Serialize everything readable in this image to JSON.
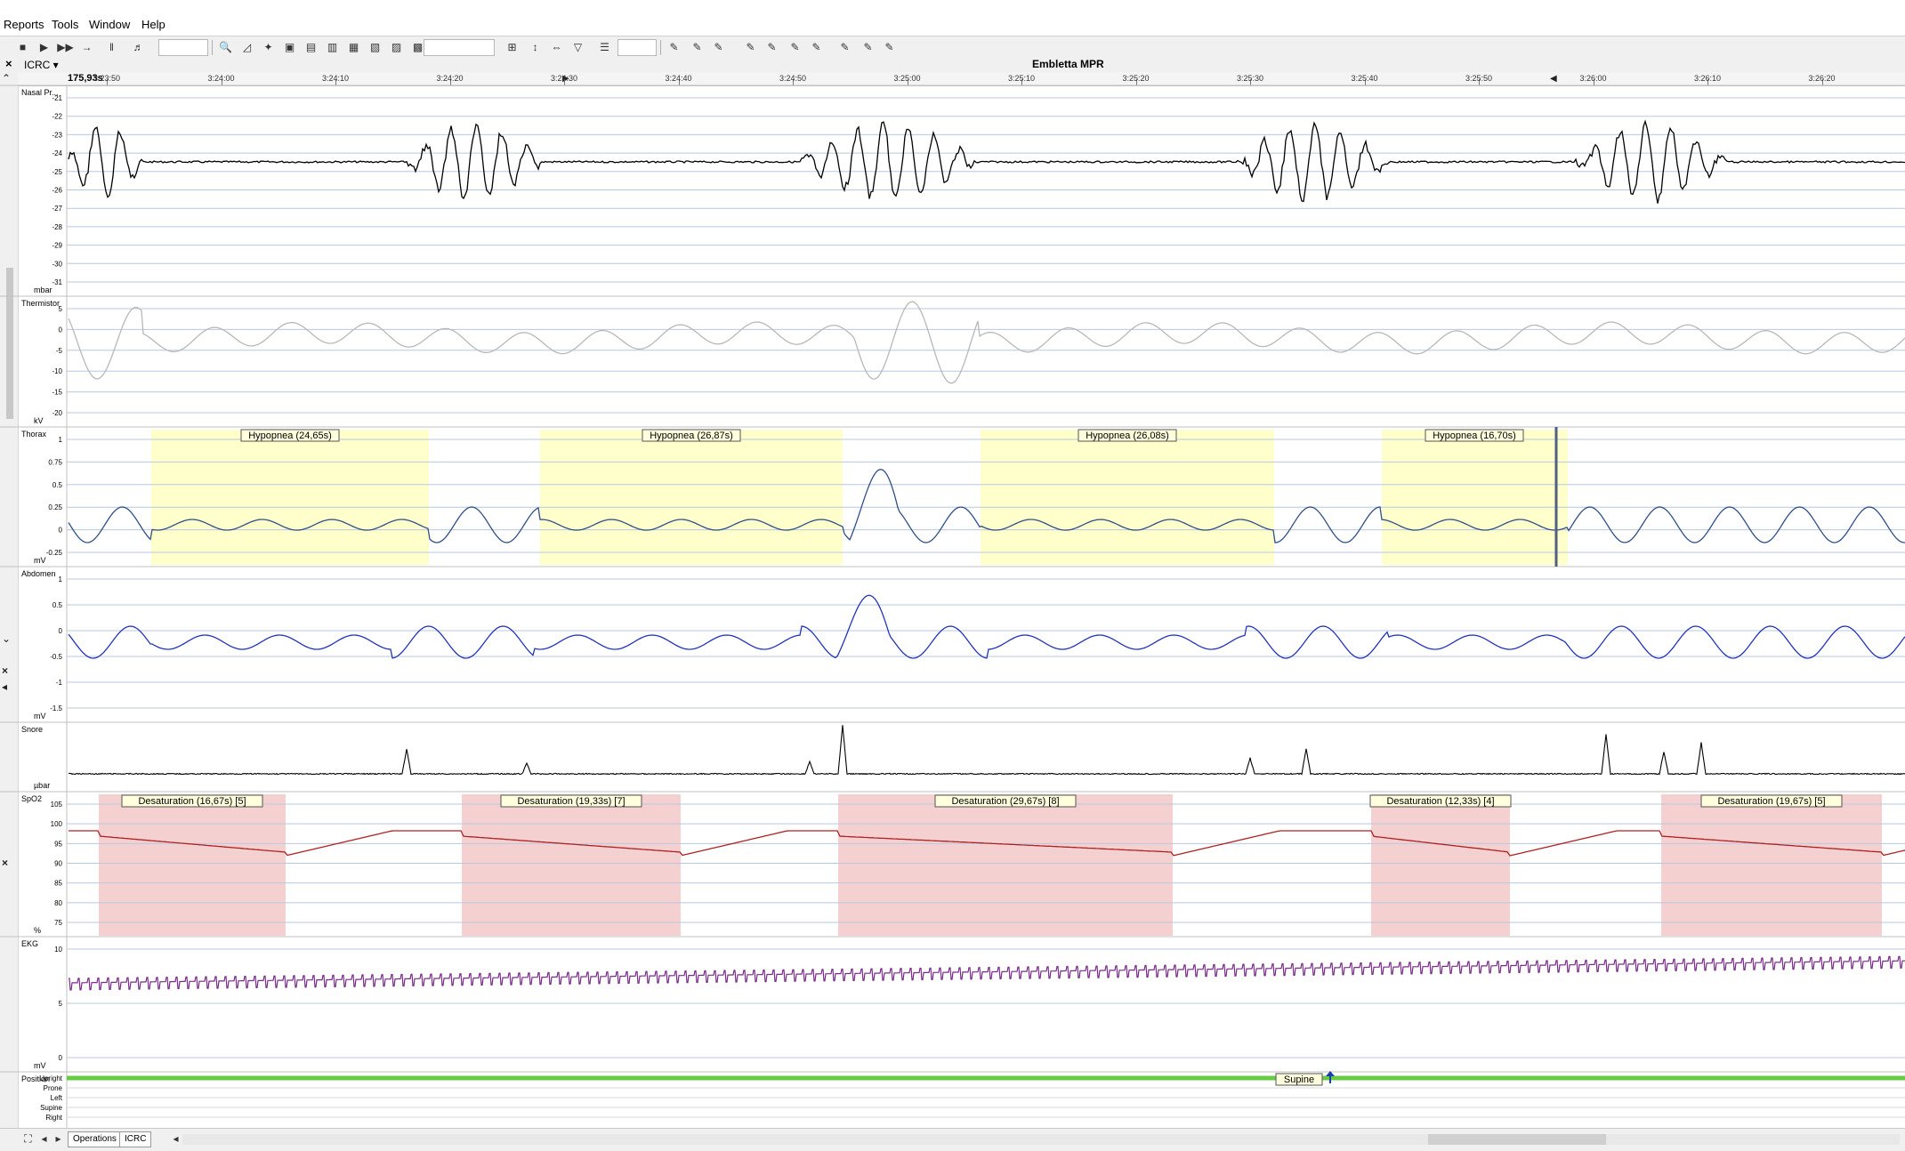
{
  "menu": {
    "items": [
      "Reports",
      "Tools",
      "Window",
      "Help"
    ]
  },
  "document": {
    "title": "Embletta MPR",
    "montage": "ICRC ▾"
  },
  "timeline": {
    "duration": "175,93s",
    "ticks": [
      "3:23:50",
      "3:24:00",
      "3:24:10",
      "3:24:20",
      "3:24:30",
      "3:24:40",
      "3:24:50",
      "3:25:00",
      "3:25:10",
      "3:25:20",
      "3:25:30",
      "3:25:40",
      "3:25:50",
      "3:26:00",
      "3:26:10",
      "3:26:20"
    ]
  },
  "channels": [
    {
      "label": "Nasal Pr...",
      "unit": "mbar",
      "yticks": [
        "-21",
        "-22",
        "-23",
        "-24",
        "-25",
        "-26",
        "-27",
        "-28",
        "-29",
        "-30",
        "-31"
      ],
      "color": "#000000"
    },
    {
      "label": "Thermistor",
      "unit": "kV",
      "yticks": [
        "5",
        "0",
        "-5",
        "-10",
        "-15",
        "-20"
      ],
      "color": "#b8b8b8"
    },
    {
      "label": "Thorax",
      "unit": "mV",
      "yticks": [
        "1",
        "0.75",
        "0.5",
        "0.25",
        "0",
        "-0.25"
      ],
      "color": "#2f4f88"
    },
    {
      "label": "Abdomen",
      "unit": "mV",
      "yticks": [
        "1",
        "0.5",
        "0",
        "-0.5",
        "-1",
        "-1.5"
      ],
      "color": "#2233bb"
    },
    {
      "label": "Snore",
      "unit": "µbar",
      "yticks": [],
      "color": "#000000"
    },
    {
      "label": "SpO2",
      "unit": "%",
      "yticks": [
        "105",
        "100",
        "95",
        "90",
        "85",
        "80",
        "75"
      ],
      "color": "#b02020"
    },
    {
      "label": "EKG",
      "unit": "mV",
      "yticks": [
        "10",
        "5",
        "0"
      ],
      "color": "#7a2a8a"
    },
    {
      "label": "Position",
      "unit": "",
      "yticks": [
        "Upright",
        "Prone",
        "Left",
        "Supine",
        "Right"
      ],
      "color": "#66cc44"
    }
  ],
  "events": {
    "hypopnea": [
      {
        "label": "Hypopnea (24,65s)"
      },
      {
        "label": "Hypopnea (26,87s)"
      },
      {
        "label": "Hypopnea (26,08s)"
      },
      {
        "label": "Hypopnea (16,70s)"
      }
    ],
    "desaturation": [
      {
        "label": "Desaturation (16,67s) [5]"
      },
      {
        "label": "Desaturation (19,33s) [7]"
      },
      {
        "label": "Desaturation (29,67s) [8]"
      },
      {
        "label": "Desaturation (12,33s) [4]"
      },
      {
        "label": "Desaturation (19,67s) [5]"
      }
    ],
    "position": {
      "label": "Supine"
    }
  },
  "tabs": [
    "Operations",
    "ICRC"
  ],
  "colors": {
    "hypopnea_fill": "#ffffcc",
    "desat_fill": "#f4d0d0",
    "grid": "#b8c8e0",
    "position_line": "#66cc44"
  }
}
